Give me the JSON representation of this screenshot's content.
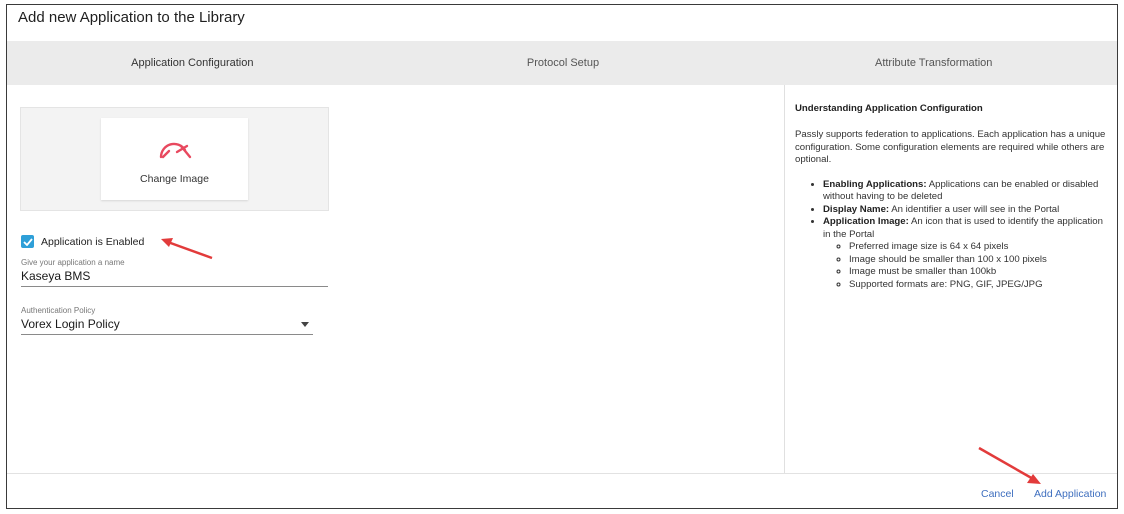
{
  "dialog": {
    "title": "Add new Application to the Library"
  },
  "steps": [
    {
      "label": "Application Configuration"
    },
    {
      "label": "Protocol Setup"
    },
    {
      "label": "Attribute Transformation"
    }
  ],
  "image_picker": {
    "change_label": "Change Image",
    "icon": "gauge-icon",
    "icon_color": "#e8495f"
  },
  "enabled_checkbox": {
    "label": "Application is Enabled",
    "checked": true,
    "color": "#2e9fd8"
  },
  "name_field": {
    "label": "Give your application a name",
    "value": "Kaseya BMS"
  },
  "policy_field": {
    "label": "Authentication Policy",
    "value": "Vorex Login Policy"
  },
  "help": {
    "title": "Understanding Application Configuration",
    "intro": "Passly supports federation to applications. Each application has a unique configuration. Some configuration elements are required while others are optional.",
    "items": [
      {
        "term": "Enabling Applications:",
        "desc": " Applications can be enabled or disabled without having to be deleted"
      },
      {
        "term": "Display Name:",
        "desc": " An identifier a user will see in the Portal"
      },
      {
        "term": "Application Image:",
        "desc": " An icon that is used to identify the application in the Portal"
      }
    ],
    "subitems": [
      "Preferred image size is 64 x 64 pixels",
      "Image should be smaller than 100 x 100 pixels",
      "Image must be smaller than 100kb",
      "Supported formats are: PNG, GIF, JPEG/JPG"
    ]
  },
  "footer": {
    "cancel_label": "Cancel",
    "add_label": "Add Application",
    "link_color": "#3f6fbf"
  },
  "annotations": {
    "arrow_color": "#e23b3b"
  }
}
